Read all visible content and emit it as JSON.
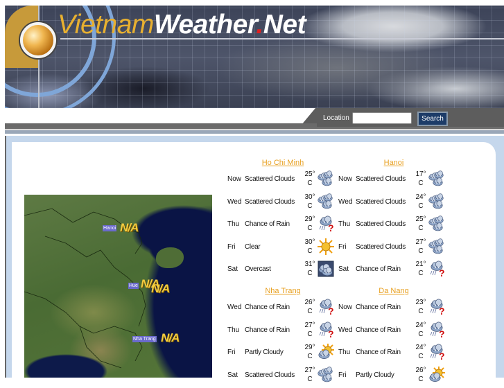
{
  "site": {
    "logo_part1": "Vietnam",
    "logo_part2": "Weather",
    "logo_dot": ".",
    "logo_part3": "Net"
  },
  "search": {
    "label": "Location",
    "value": "",
    "placeholder": "",
    "button_label": "Search"
  },
  "map": {
    "cities": [
      {
        "name": "Hanoi",
        "value": "N/A"
      },
      {
        "name": "Hue",
        "value": "N/A"
      },
      {
        "name": "Hue-2",
        "value": "N/A"
      },
      {
        "name": "Nha Trang",
        "value": "N/A"
      }
    ],
    "labels": {
      "hanoi": "Hanoi",
      "hue": "Hue",
      "nha_trang": "Nha Trang",
      "na": "N/A"
    }
  },
  "forecasts": [
    {
      "city": "Ho Chi Minh",
      "rows": [
        {
          "day": "Now",
          "condition": "Scattered Clouds",
          "temp": "25°",
          "unit": "C",
          "icon": "scattered-clouds"
        },
        {
          "day": "Wed",
          "condition": "Scattered Clouds",
          "temp": "30°",
          "unit": "C",
          "icon": "scattered-clouds"
        },
        {
          "day": "Thu",
          "condition": "Chance of Rain",
          "temp": "29°",
          "unit": "C",
          "icon": "chance-of-rain"
        },
        {
          "day": "Fri",
          "condition": "Clear",
          "temp": "30°",
          "unit": "C",
          "icon": "clear"
        },
        {
          "day": "Sat",
          "condition": "Overcast",
          "temp": "31°",
          "unit": "C",
          "icon": "overcast"
        }
      ]
    },
    {
      "city": "Hanoi",
      "rows": [
        {
          "day": "Now",
          "condition": "Scattered Clouds",
          "temp": "17°",
          "unit": "C",
          "icon": "scattered-clouds"
        },
        {
          "day": "Wed",
          "condition": "Scattered Clouds",
          "temp": "24°",
          "unit": "C",
          "icon": "scattered-clouds"
        },
        {
          "day": "Thu",
          "condition": "Scattered Clouds",
          "temp": "25°",
          "unit": "C",
          "icon": "scattered-clouds"
        },
        {
          "day": "Fri",
          "condition": "Scattered Clouds",
          "temp": "27°",
          "unit": "C",
          "icon": "scattered-clouds"
        },
        {
          "day": "Sat",
          "condition": "Chance of Rain",
          "temp": "21°",
          "unit": "C",
          "icon": "chance-of-rain"
        }
      ]
    },
    {
      "city": "Nha Trang",
      "rows": [
        {
          "day": "Wed",
          "condition": "Chance of Rain",
          "temp": "26°",
          "unit": "C",
          "icon": "chance-of-rain"
        },
        {
          "day": "Thu",
          "condition": "Chance of Rain",
          "temp": "27°",
          "unit": "C",
          "icon": "chance-of-rain"
        },
        {
          "day": "Fri",
          "condition": "Partly Cloudy",
          "temp": "29°",
          "unit": "C",
          "icon": "partly-cloudy"
        },
        {
          "day": "Sat",
          "condition": "Scattered Clouds",
          "temp": "27°",
          "unit": "C",
          "icon": "scattered-clouds"
        }
      ]
    },
    {
      "city": "Da Nang",
      "rows": [
        {
          "day": "Now",
          "condition": "Chance of Rain",
          "temp": "23°",
          "unit": "C",
          "icon": "chance-of-rain"
        },
        {
          "day": "Wed",
          "condition": "Chance of Rain",
          "temp": "24°",
          "unit": "C",
          "icon": "chance-of-rain"
        },
        {
          "day": "Thu",
          "condition": "Chance of Rain",
          "temp": "24°",
          "unit": "C",
          "icon": "chance-of-rain"
        },
        {
          "day": "Fri",
          "condition": "Partly Cloudy",
          "temp": "26°",
          "unit": "C",
          "icon": "partly-cloudy"
        }
      ]
    }
  ]
}
